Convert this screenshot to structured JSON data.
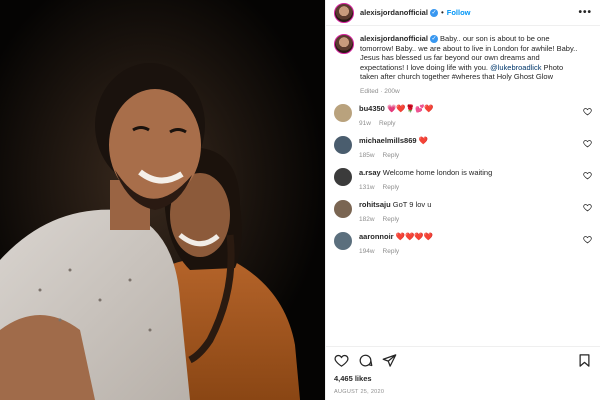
{
  "header": {
    "username": "alexisjordanofficial",
    "separator": "•",
    "follow_label": "Follow",
    "more_label": "•••"
  },
  "caption": {
    "username": "alexisjordanofficial",
    "text_1": " Baby.. our son is about to be one tomorrow! Baby.. we are about to live in London for awhile! Baby.. Jesus has blessed us far beyond our own dreams and expectations! I love doing life with you. ",
    "mention": "@lukebroadlick",
    "text_2": " Photo taken after church together #wheres that Holy Ghost Glow",
    "meta": "Edited · 200w"
  },
  "comments": [
    {
      "username": "bu4350",
      "text": " 💗❤️🌹💕❤️",
      "time": "91w",
      "reply": "Reply",
      "avatar_color": "#b9a27d"
    },
    {
      "username": "michaelmills869",
      "text": " ❤️",
      "time": "185w",
      "reply": "Reply",
      "avatar_color": "#4a5d6e"
    },
    {
      "username": "a.rsay",
      "text": " Welcome home london is waiting",
      "time": "131w",
      "reply": "Reply",
      "avatar_color": "#3b3b3b"
    },
    {
      "username": "rohitsaju",
      "text": " GoT 9 lov u",
      "time": "182w",
      "reply": "Reply",
      "avatar_color": "#7a6552"
    },
    {
      "username": "aaronnoir",
      "text": " ❤️❤️❤️❤️",
      "time": "194w",
      "reply": "Reply",
      "avatar_color": "#5b6f7d"
    }
  ],
  "likes": "4,465 likes",
  "date": "AUGUST 25, 2020",
  "icons": [
    "heart-icon",
    "comment-icon",
    "share-icon",
    "save-icon",
    "more-icon",
    "verified-icon"
  ]
}
